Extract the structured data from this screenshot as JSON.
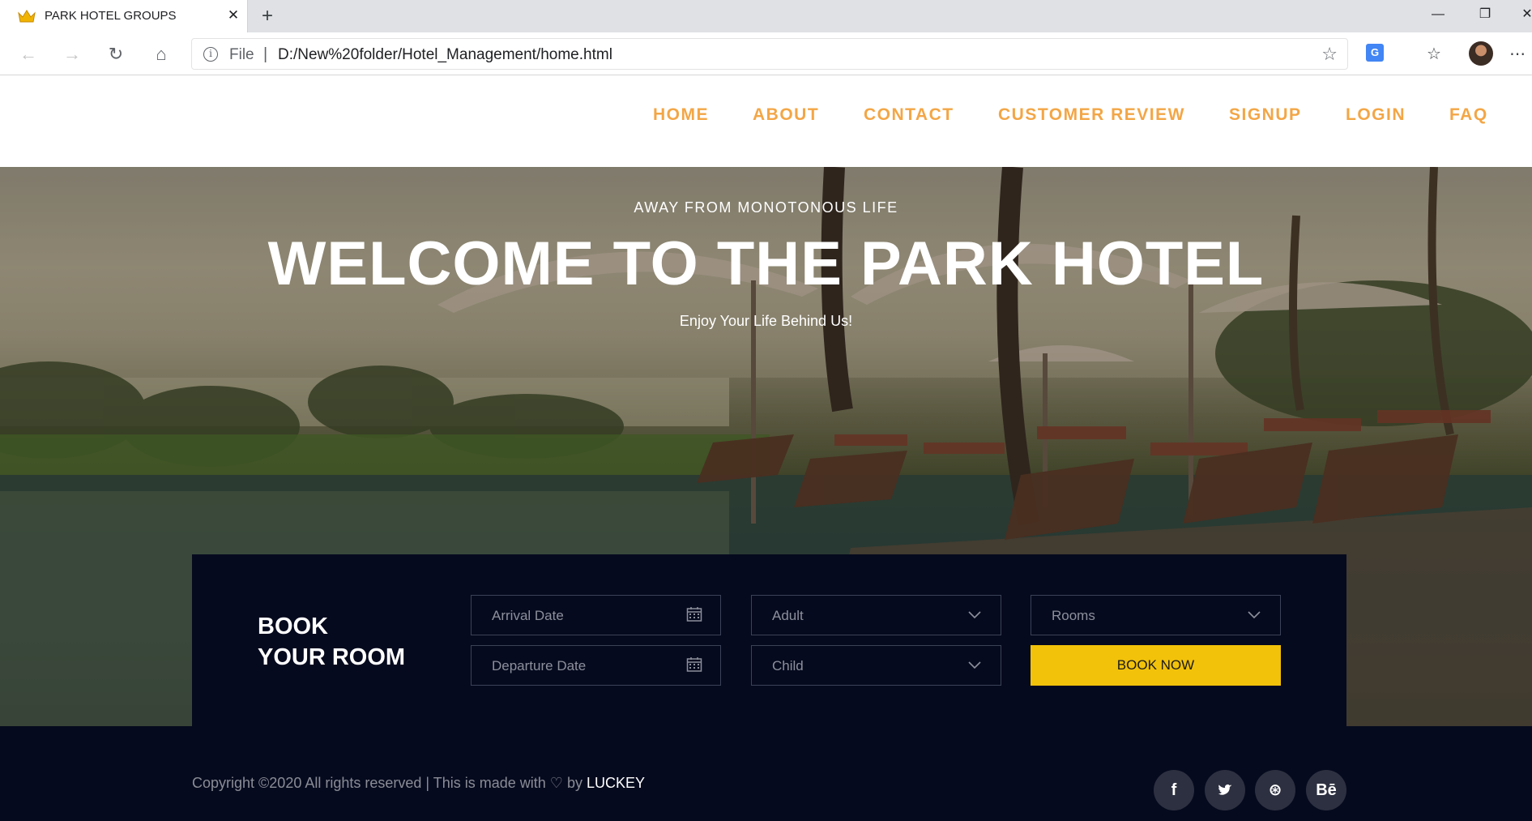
{
  "browser": {
    "tab_title": "PARK HOTEL GROUPS",
    "tab_close": "✕",
    "new_tab": "+",
    "scheme_label": "File",
    "separator": "|",
    "url": "D:/New%20folder/Hotel_Management/home.html",
    "window_controls": [
      "—",
      "❐",
      "✕"
    ],
    "icons": [
      "back-arrow-icon",
      "forward-arrow-icon",
      "reload-icon",
      "home-icon",
      "info-icon",
      "bookmark-star-icon",
      "translate-icon",
      "favorites-icon",
      "profile-avatar",
      "more-menu-icon"
    ]
  },
  "nav": {
    "items": [
      "HOME",
      "ABOUT",
      "CONTACT",
      "CUSTOMER REVIEW",
      "SIGNUP",
      "LOGIN",
      "FAQ"
    ],
    "color": "#f3a646"
  },
  "hero": {
    "kicker": "AWAY FROM MONOTONOUS LIFE",
    "title": "WELCOME TO THE PARK HOTEL",
    "tagline": "Enjoy Your Life Behind Us!"
  },
  "booking": {
    "heading_line1": "BOOK",
    "heading_line2": "YOUR ROOM",
    "arrival_placeholder": "Arrival Date",
    "departure_placeholder": "Departure Date",
    "adult_select": "Adult",
    "child_select": "Child",
    "rooms_select": "Rooms",
    "book_button": "BOOK NOW",
    "accent_color": "#f2c20a",
    "panel_color": "#060a1e"
  },
  "footer": {
    "copyright_text": "Copyright ©2020 All rights reserved | This is made with ♡ by ",
    "author": "LUCKEY",
    "social": [
      {
        "icon": "facebook-icon",
        "glyph": "f"
      },
      {
        "icon": "twitter-icon",
        "glyph": "🐦"
      },
      {
        "icon": "dribbble-icon",
        "glyph": "⊛"
      },
      {
        "icon": "behance-icon",
        "glyph": "Bē"
      }
    ]
  }
}
